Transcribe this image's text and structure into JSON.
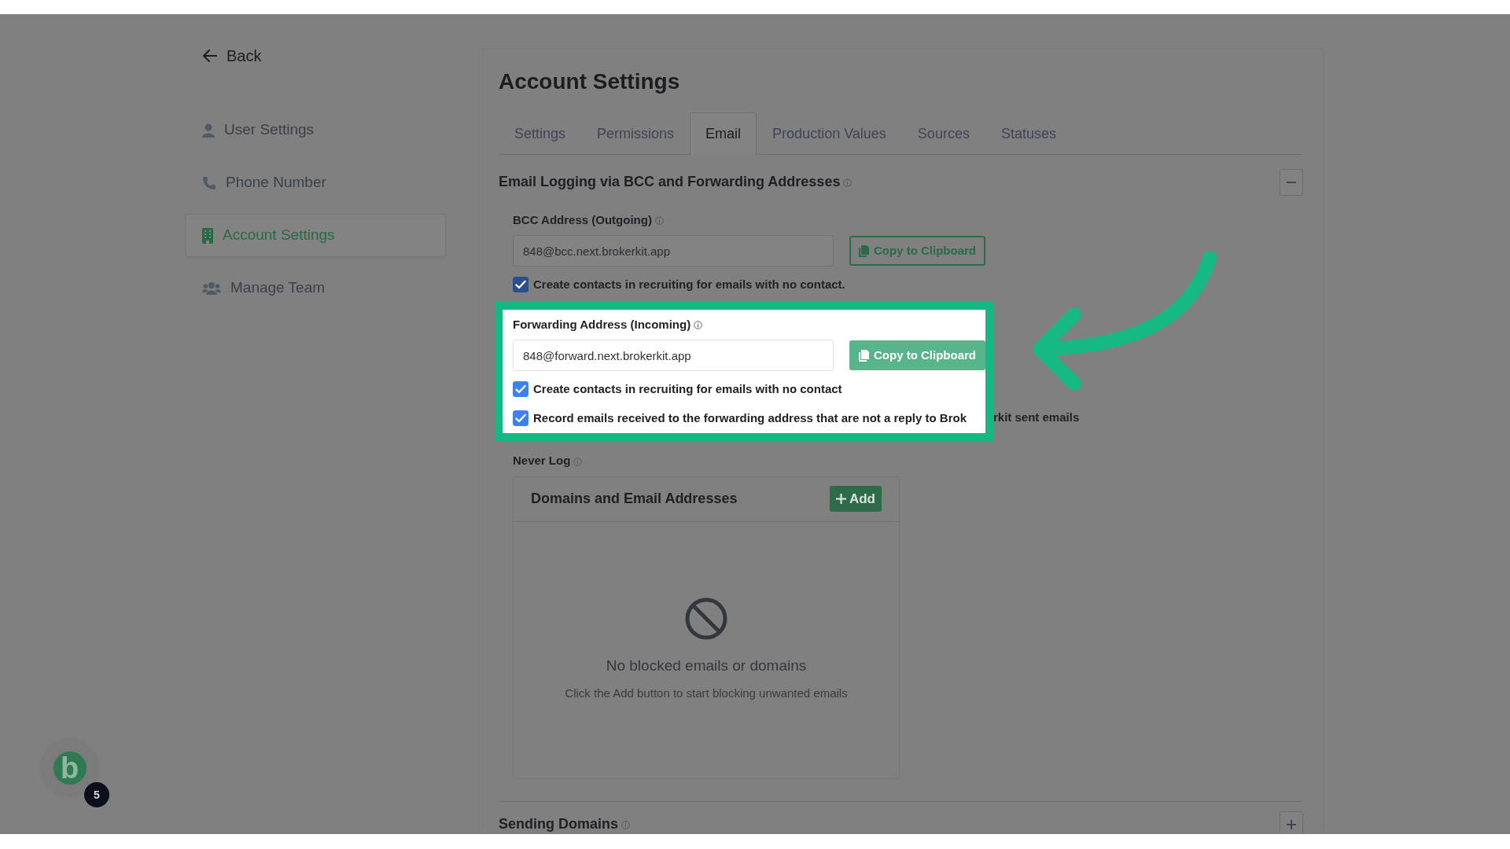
{
  "sidebar": {
    "back": "Back",
    "items": [
      {
        "label": "User Settings",
        "selected": false
      },
      {
        "label": "Phone Number",
        "selected": false
      },
      {
        "label": "Account Settings",
        "selected": true
      },
      {
        "label": "Manage Team",
        "selected": false
      }
    ]
  },
  "title": "Account Settings",
  "tabs": [
    {
      "label": "Settings",
      "selected": false
    },
    {
      "label": "Permissions",
      "selected": false
    },
    {
      "label": "Email",
      "selected": true
    },
    {
      "label": "Production Values",
      "selected": false
    },
    {
      "label": "Sources",
      "selected": false
    },
    {
      "label": "Statuses",
      "selected": false
    }
  ],
  "section": {
    "heading": "Email Logging via BCC and Forwarding Addresses",
    "expanded": true,
    "bcc": {
      "label": "BCC Address (Outgoing)",
      "value": "848@bcc.next.brokerkit.app",
      "button": "Copy to Clipboard",
      "checkboxes": [
        {
          "text": "Create contacts in recruiting for emails with no contact.",
          "checked": true
        }
      ]
    },
    "forwarding": {
      "highlighted": true,
      "label": "Forwarding Address (Incoming)",
      "value": "848@forward.next.brokerkit.app",
      "button": "Copy to Clipboard",
      "checkboxes": [
        {
          "text": "Create contacts in recruiting for emails with no contact",
          "checked": true
        },
        {
          "text": "Record emails received to the forwarding address that are not a reply to Brok",
          "overflow": "rkit sent emails",
          "checked": true
        }
      ]
    },
    "never_log": {
      "label": "Never Log",
      "card_title": "Domains and Email Addresses",
      "add_button": "Add",
      "empty_title": "No blocked emails or domains",
      "empty_text": "Click the Add button to start blocking unwanted emails"
    }
  },
  "section_2": {
    "heading": "Sending Domains",
    "expanded": false
  },
  "widget": {
    "logo_letter": "b",
    "badge": "5"
  }
}
